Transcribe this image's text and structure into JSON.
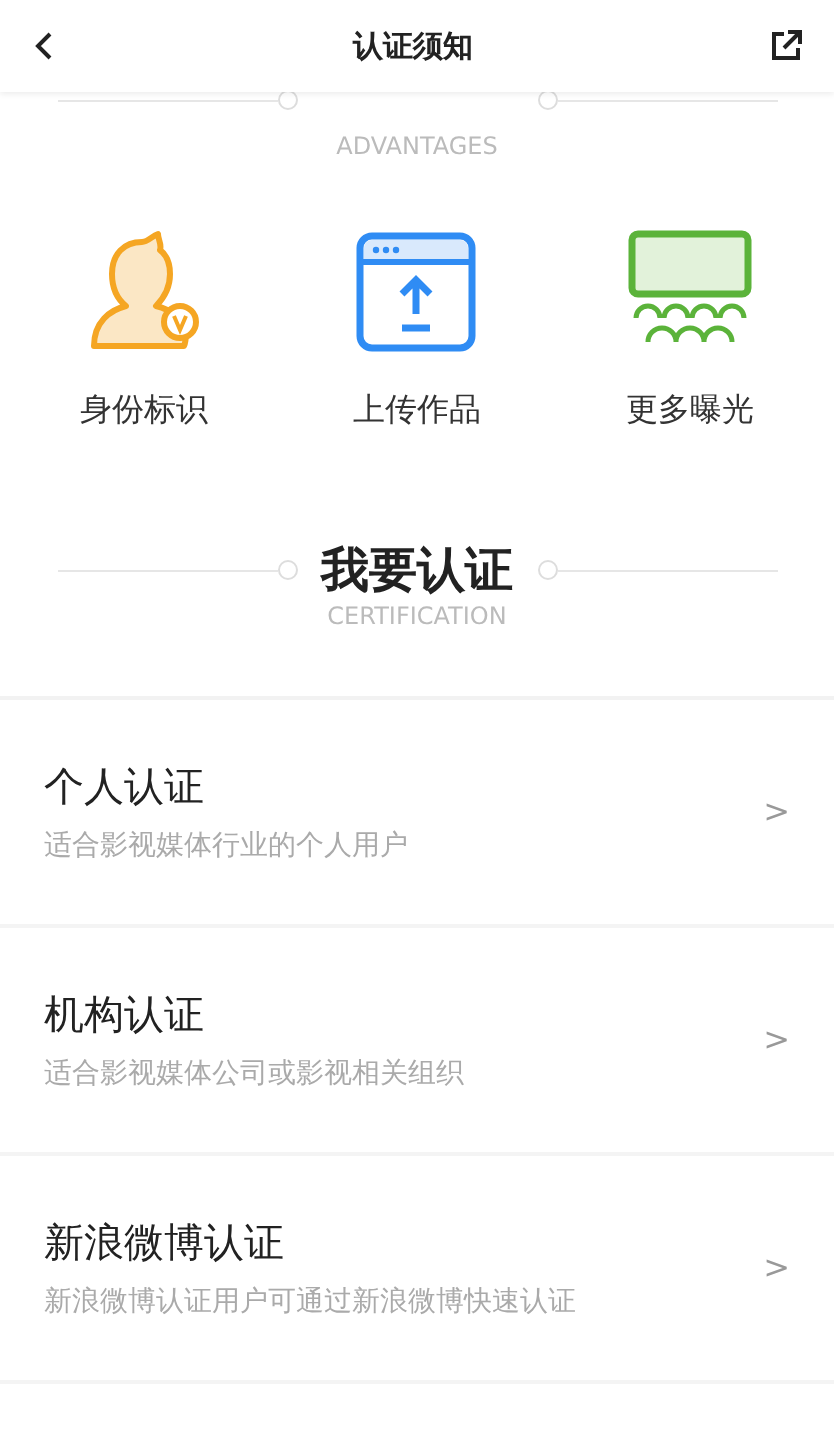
{
  "header": {
    "title": "认证须知"
  },
  "advantages": {
    "subtitle": "ADVANTAGES",
    "items": [
      {
        "kind": "identity",
        "label": "身份标识"
      },
      {
        "kind": "upload",
        "label": "上传作品"
      },
      {
        "kind": "exposure",
        "label": "更多曝光"
      }
    ]
  },
  "certification": {
    "title": "我要认证",
    "subtitle": "CERTIFICATION",
    "options": [
      {
        "title": "个人认证",
        "description": "适合影视媒体行业的个人用户",
        "arrow": ">"
      },
      {
        "title": "机构认证",
        "description": "适合影视媒体公司或影视相关组织",
        "arrow": ">"
      },
      {
        "title": "新浪微博认证",
        "description": "新浪微博认证用户可通过新浪微博快速认证",
        "arrow": ">"
      }
    ]
  }
}
